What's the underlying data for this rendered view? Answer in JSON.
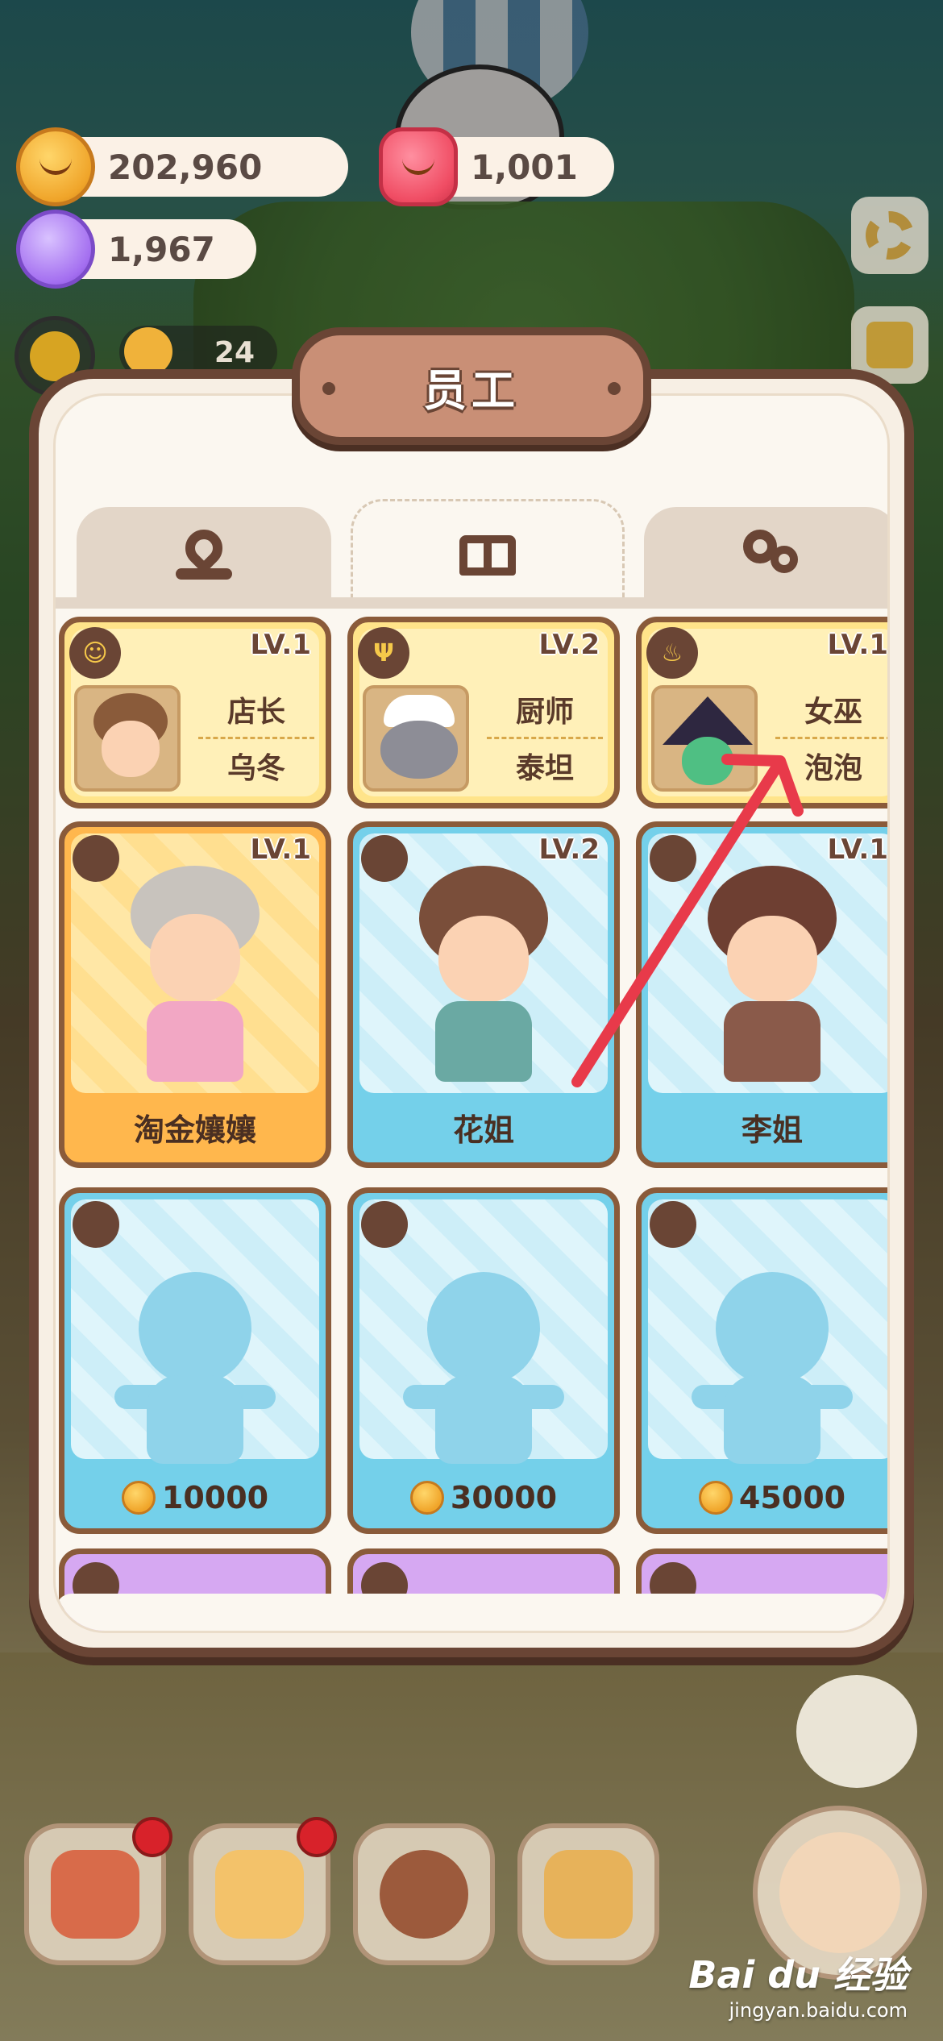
{
  "currency": {
    "coins": "202,960",
    "gems": "1,001",
    "candy": "1,967"
  },
  "player": {
    "level_badge": "24"
  },
  "modal": {
    "title": "员工",
    "tabs": [
      {
        "icon": "map-pin-icon",
        "active": false
      },
      {
        "icon": "book-icon",
        "active": true
      },
      {
        "icon": "gears-icon",
        "active": false
      }
    ]
  },
  "managers": [
    {
      "level": "LV.1",
      "role": "店长",
      "name": "乌冬",
      "icon": "chef-badge-icon"
    },
    {
      "level": "LV.2",
      "role": "厨师",
      "name": "泰坦",
      "icon": "fork-spoon-icon"
    },
    {
      "level": "LV.1",
      "role": "女巫",
      "name": "泡泡",
      "icon": "cauldron-icon"
    }
  ],
  "staff": [
    {
      "level": "LV.1",
      "name": "淘金孃孃",
      "style": "orange"
    },
    {
      "level": "LV.2",
      "name": "花姐",
      "style": "blue"
    },
    {
      "level": "LV.1",
      "name": "李姐",
      "style": "blue"
    }
  ],
  "locked_staff": [
    {
      "price": "10000"
    },
    {
      "price": "30000"
    },
    {
      "price": "45000"
    }
  ],
  "watermark": {
    "brand": "Bai du 经验",
    "url": "jingyan.baidu.com"
  },
  "colors": {
    "frame": "#6a4535",
    "card_gold": "#ffe48a",
    "card_orange": "#ffb74d",
    "card_blue": "#74d0ea",
    "card_purple": "#d6a8f2",
    "arrow": "#e83a4a"
  }
}
